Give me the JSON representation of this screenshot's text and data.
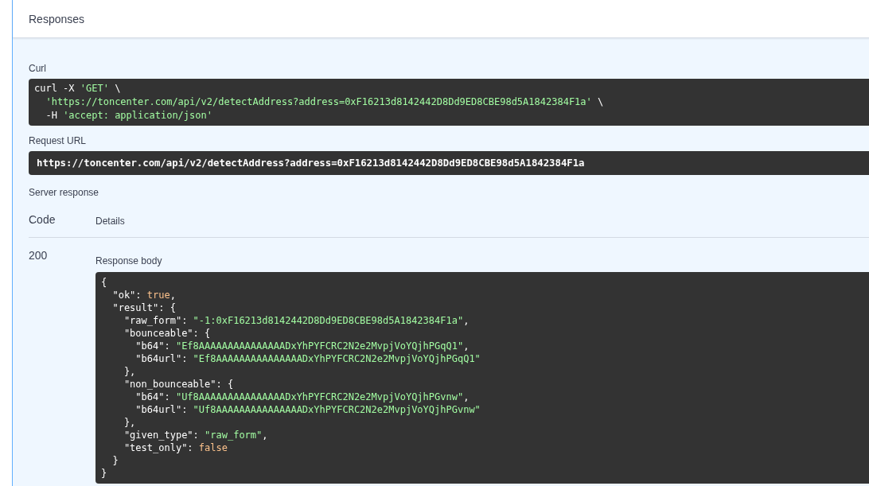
{
  "section_title": "Responses",
  "curl": {
    "label": "Curl",
    "lines": [
      [
        {
          "text": "curl -X ",
          "kind": "plain"
        },
        {
          "text": "'GET'",
          "kind": "string"
        },
        {
          "text": " \\",
          "kind": "plain"
        }
      ],
      [
        {
          "text": "  'https://toncenter.com/api/v2/detectAddress?address=0xF16213d8142442D8Dd9ED8CBE98d5A1842384F1a'",
          "kind": "string"
        },
        {
          "text": " \\",
          "kind": "plain"
        }
      ],
      [
        {
          "text": "  -H ",
          "kind": "plain"
        },
        {
          "text": "'accept: application/json'",
          "kind": "string"
        }
      ]
    ]
  },
  "request_url": {
    "label": "Request URL",
    "url": "https://toncenter.com/api/v2/detectAddress?address=0xF16213d8142442D8Dd9ED8CBE98d5A1842384F1a"
  },
  "server_response": {
    "label": "Server response",
    "columns": [
      "Code",
      "Details"
    ],
    "rows": [
      {
        "code": "200",
        "body_label": "Response body",
        "lines": [
          [
            {
              "text": "{",
              "kind": "plain"
            }
          ],
          [
            {
              "text": "  \"ok\": ",
              "kind": "plain"
            },
            {
              "text": "true",
              "kind": "literal"
            },
            {
              "text": ",",
              "kind": "plain"
            }
          ],
          [
            {
              "text": "  \"result\": {",
              "kind": "plain"
            }
          ],
          [
            {
              "text": "    \"raw_form\": ",
              "kind": "plain"
            },
            {
              "text": "\"-1:0xF16213d8142442D8Dd9ED8CBE98d5A1842384F1a\"",
              "kind": "string"
            },
            {
              "text": ",",
              "kind": "plain"
            }
          ],
          [
            {
              "text": "    \"bounceable\": {",
              "kind": "plain"
            }
          ],
          [
            {
              "text": "      \"b64\": ",
              "kind": "plain"
            },
            {
              "text": "\"Ef8AAAAAAAAAAAAAAADxYhPYFCRC2N2e2MvpjVoYQjhPGqQ1\"",
              "kind": "string"
            },
            {
              "text": ",",
              "kind": "plain"
            }
          ],
          [
            {
              "text": "      \"b64url\": ",
              "kind": "plain"
            },
            {
              "text": "\"Ef8AAAAAAAAAAAAAAADxYhPYFCRC2N2e2MvpjVoYQjhPGqQ1\"",
              "kind": "string"
            }
          ],
          [
            {
              "text": "    },",
              "kind": "plain"
            }
          ],
          [
            {
              "text": "    \"non_bounceable\": {",
              "kind": "plain"
            }
          ],
          [
            {
              "text": "      \"b64\": ",
              "kind": "plain"
            },
            {
              "text": "\"Uf8AAAAAAAAAAAAAAADxYhPYFCRC2N2e2MvpjVoYQjhPGvnw\"",
              "kind": "string"
            },
            {
              "text": ",",
              "kind": "plain"
            }
          ],
          [
            {
              "text": "      \"b64url\": ",
              "kind": "plain"
            },
            {
              "text": "\"Uf8AAAAAAAAAAAAAAADxYhPYFCRC2N2e2MvpjVoYQjhPGvnw\"",
              "kind": "string"
            }
          ],
          [
            {
              "text": "    },",
              "kind": "plain"
            }
          ],
          [
            {
              "text": "    \"given_type\": ",
              "kind": "plain"
            },
            {
              "text": "\"raw_form\"",
              "kind": "string"
            },
            {
              "text": ",",
              "kind": "plain"
            }
          ],
          [
            {
              "text": "    \"test_only\": ",
              "kind": "plain"
            },
            {
              "text": "false",
              "kind": "literal"
            }
          ],
          [
            {
              "text": "  }",
              "kind": "plain"
            }
          ],
          [
            {
              "text": "}",
              "kind": "plain"
            }
          ]
        ]
      }
    ]
  }
}
